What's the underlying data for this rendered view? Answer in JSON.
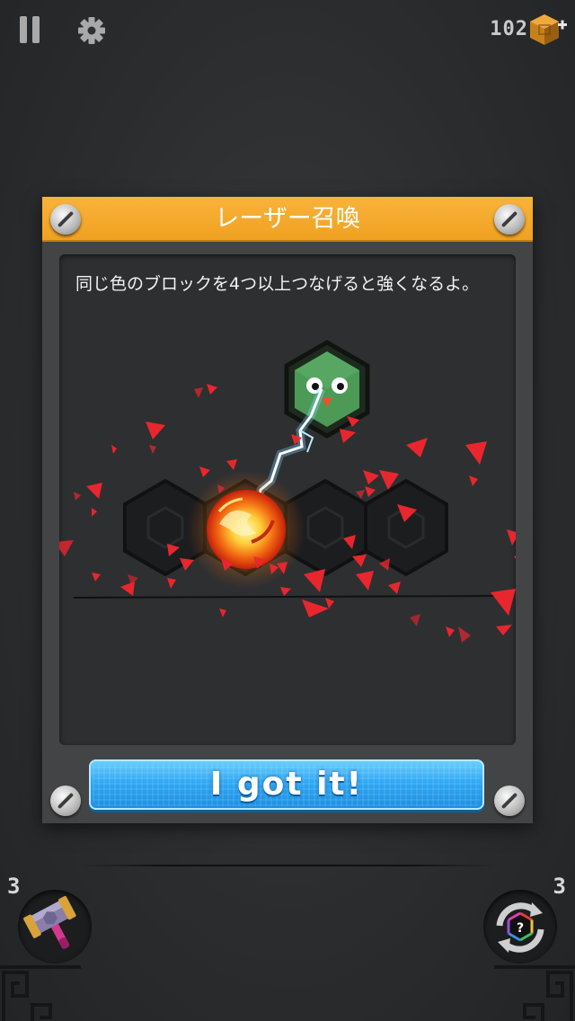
{
  "top_bar": {
    "pause_icon": "pause-icon",
    "settings_icon": "gear-icon",
    "currency_count": "102",
    "currency_icon": "orange-cube-plus-icon"
  },
  "dialog": {
    "title": "レーザー召喚",
    "description": "同じ色のブロックを4つ以上つなげると強くなるよ。",
    "confirm_label": "I got it!",
    "accent_color": "#f5a623",
    "button_color": "#2fa8f4"
  },
  "tools": {
    "hammer_count": "3",
    "hammer_icon": "hammer-icon",
    "shuffle_count": "3",
    "shuffle_icon": "shuffle-question-icon"
  }
}
